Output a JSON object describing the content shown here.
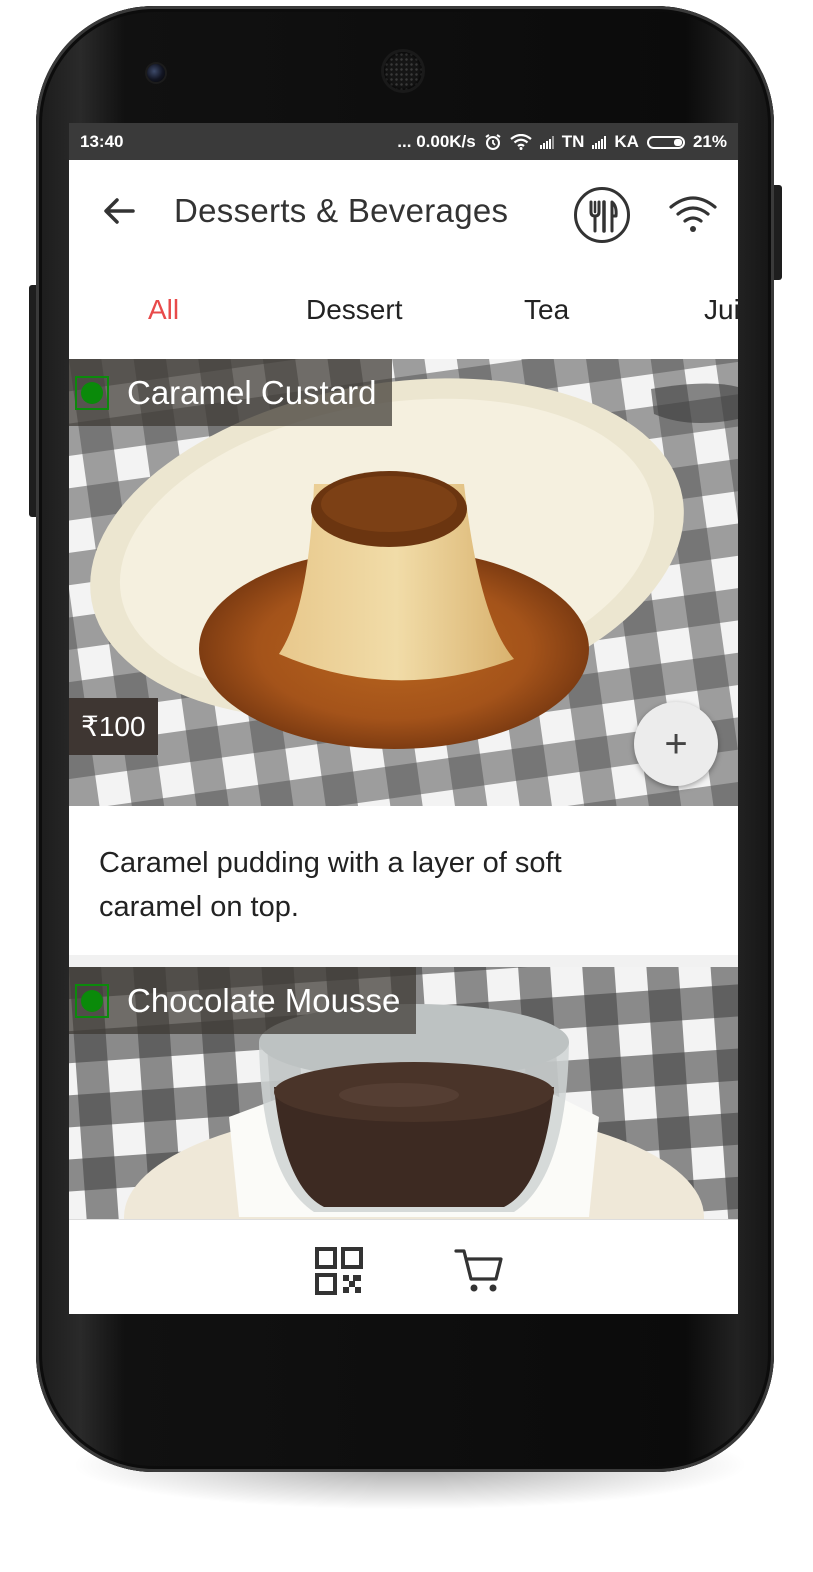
{
  "status_bar": {
    "time": "13:40",
    "network_speed": "... 0.00K/s",
    "carrier1": "TN",
    "carrier2": "KA",
    "battery": "21%"
  },
  "toolbar": {
    "title": "Desserts & Beverages",
    "back_icon": "arrow-left-icon",
    "menu_icon": "fork-knife-icon",
    "wifi_icon": "wifi-icon"
  },
  "tabs": [
    {
      "label": "All",
      "active": true
    },
    {
      "label": "Dessert",
      "active": false
    },
    {
      "label": "Tea",
      "active": false
    },
    {
      "label": "Jui",
      "active": false
    }
  ],
  "items": [
    {
      "name": "Caramel Custard",
      "price": "₹100",
      "description_line1": "Caramel pudding with a layer of soft",
      "description_line2": "caramel on top.",
      "veg": true,
      "add_label": "+"
    },
    {
      "name": "Chocolate Mousse",
      "veg": true
    }
  ],
  "bottom_nav": {
    "qr_icon": "qr-code-icon",
    "cart_icon": "cart-icon"
  },
  "colors": {
    "accent": "#e84a4a",
    "veg": "#0a8a0a",
    "status_bar": "#3a3a3a"
  }
}
